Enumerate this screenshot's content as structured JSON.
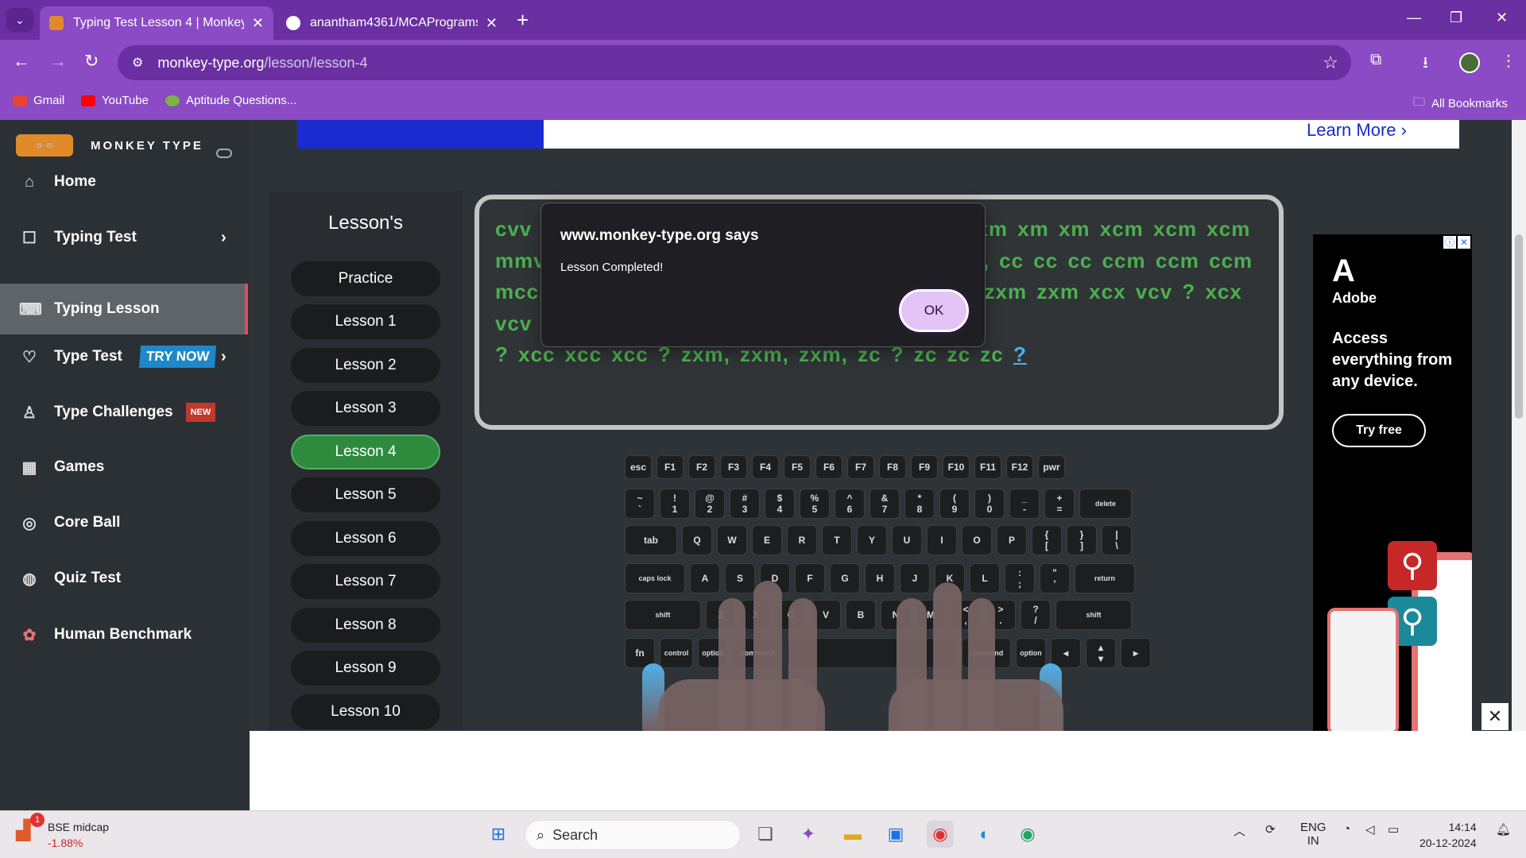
{
  "browser": {
    "tabs": [
      {
        "title": "Typing Test Lesson 4 | Monkey-",
        "close": "✕"
      },
      {
        "title": "anantham4361/MCAPrograms",
        "close": "✕"
      }
    ],
    "new_tab": "+",
    "url_host": "monkey-type.org",
    "url_path": "/lesson/lesson-4",
    "bookmarks": [
      "Gmail",
      "YouTube",
      "Aptitude Questions..."
    ],
    "all_bookmarks": "All Bookmarks"
  },
  "ads": {
    "top_learn_more": "Learn More ›",
    "side": {
      "brand": "Adobe",
      "headline": "Access everything from any device.",
      "cta": "Try free",
      "close": "✕"
    }
  },
  "sidebar": {
    "brand": "MONKEY TYPE",
    "items": [
      {
        "label": "Home",
        "icon": "home-icon"
      },
      {
        "label": "Typing Test",
        "icon": "typing-test-icon"
      },
      {
        "label": "Typing Lesson",
        "icon": "keyboard-icon"
      },
      {
        "label": "Type Test",
        "icon": "type-test-icon",
        "badge": "TRY NOW"
      },
      {
        "label": "Type Challenges",
        "icon": "medal-icon",
        "badge": "NEW"
      },
      {
        "label": "Games",
        "icon": "grid-icon"
      },
      {
        "label": "Core Ball",
        "icon": "target-icon"
      },
      {
        "label": "Quiz Test",
        "icon": "quiz-icon"
      },
      {
        "label": "Human Benchmark",
        "icon": "brain-icon"
      }
    ]
  },
  "lessons": {
    "title": "Lesson's",
    "items": [
      "Practice",
      "Lesson 1",
      "Lesson 2",
      "Lesson 3",
      "Lesson 4",
      "Lesson 5",
      "Lesson 6",
      "Lesson 7",
      "Lesson 8",
      "Lesson 9",
      "Lesson 10"
    ],
    "active": "Lesson 4"
  },
  "typing": {
    "line1": "cvv cvv cvv mcc mcc mcc mmc mmc mmc xm xm xm xcm xcm xcm",
    "line2": "mmv mmv mmv zc zc zc cc, cc, xm, xm, zm, cc cc cc ccm ccm ccm",
    "line3": "mcc, mcc, m. c. c. z. c. c. c, z, x, c, v, zxm zxm zxm xcx vcv ? xcx vcv",
    "line4": "? xcc xcc xcc ? zxm, zxm, zxm, zc ? zc zc zc",
    "cursor_char": "?"
  },
  "keyboard": {
    "row_fn": [
      "esc",
      "F1",
      "F2",
      "F3",
      "F4",
      "F5",
      "F6",
      "F7",
      "F8",
      "F9",
      "F10",
      "F11",
      "F12",
      "pwr"
    ],
    "row_num": [
      "~\n`",
      "!\n1",
      "@\n2",
      "#\n3",
      "$\n4",
      "%\n5",
      "^\n6",
      "&\n7",
      "*\n8",
      "(\n9",
      ")\n0",
      "_\n-",
      "+\n=",
      "delete"
    ],
    "row_q": [
      "tab",
      "Q",
      "W",
      "E",
      "R",
      "T",
      "Y",
      "U",
      "I",
      "O",
      "P",
      "{\n[",
      "}\n]",
      "|\n\\"
    ],
    "row_a": [
      "caps lock",
      "A",
      "S",
      "D",
      "F",
      "G",
      "H",
      "J",
      "K",
      "L",
      ":\n;",
      "\"\n'",
      "return"
    ],
    "row_z": [
      "shift",
      "Z",
      "X",
      "C",
      "V",
      "B",
      "N",
      "M",
      "<\n,",
      ">\n.",
      "?\n/",
      "shift"
    ],
    "row_mod": [
      "fn",
      "control",
      "option",
      "command",
      "",
      "command",
      "option",
      "◂",
      "▴\n▾",
      "▸"
    ]
  },
  "dialog": {
    "title": "www.monkey-type.org says",
    "message": "Lesson Completed!",
    "ok": "OK"
  },
  "taskbar": {
    "stock_name": "BSE midcap",
    "stock_change": "-1.88%",
    "stock_badge": "1",
    "search": "Search",
    "lang1": "ENG",
    "lang2": "IN",
    "time": "14:14",
    "date": "20-12-2024"
  }
}
